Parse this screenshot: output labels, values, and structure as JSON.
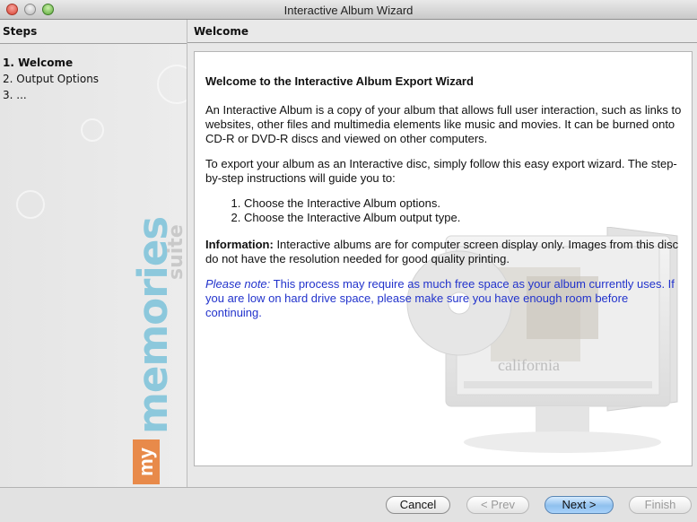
{
  "window": {
    "title": "Interactive Album Wizard"
  },
  "sidebar": {
    "header": "Steps",
    "steps": [
      {
        "label": "1. Welcome",
        "current": true
      },
      {
        "label": "2. Output Options",
        "current": false
      },
      {
        "label": "3. ...",
        "current": false
      }
    ],
    "brand": {
      "my": "my",
      "word": "memories",
      "suite": "suite"
    }
  },
  "main": {
    "header": "Welcome",
    "heading": "Welcome to the Interactive Album Export Wizard",
    "intro": "An Interactive Album is a copy of your album that allows full user interaction, such as links to websites, other files and multimedia elements like music and movies. It can be burned onto CD-R or DVD-R discs and viewed on other computers.",
    "instructions": "To export your album as an Interactive disc, simply follow this easy export wizard. The step-by-step instructions will guide you to:",
    "list": [
      "Choose the Interactive Album options.",
      "Choose the Interactive Album output type."
    ],
    "info_label": "Information:",
    "info_text": " Interactive albums are for computer screen display only. Images from this disc do not have the resolution needed for good quality printing.",
    "note_label": "Please note:",
    "note_text": " This process may require as much free space as your album currently uses. If you are low on hard drive space, please make sure you have enough room before continuing.",
    "art_caption": "california"
  },
  "buttons": {
    "cancel": "Cancel",
    "prev": "< Prev",
    "next": "Next >",
    "finish": "Finish"
  },
  "colors": {
    "note_text": "#2233cc",
    "brand_my": "#e88a4a",
    "brand_word": "#8cc8dc",
    "default_button": "#8fc0ee"
  }
}
